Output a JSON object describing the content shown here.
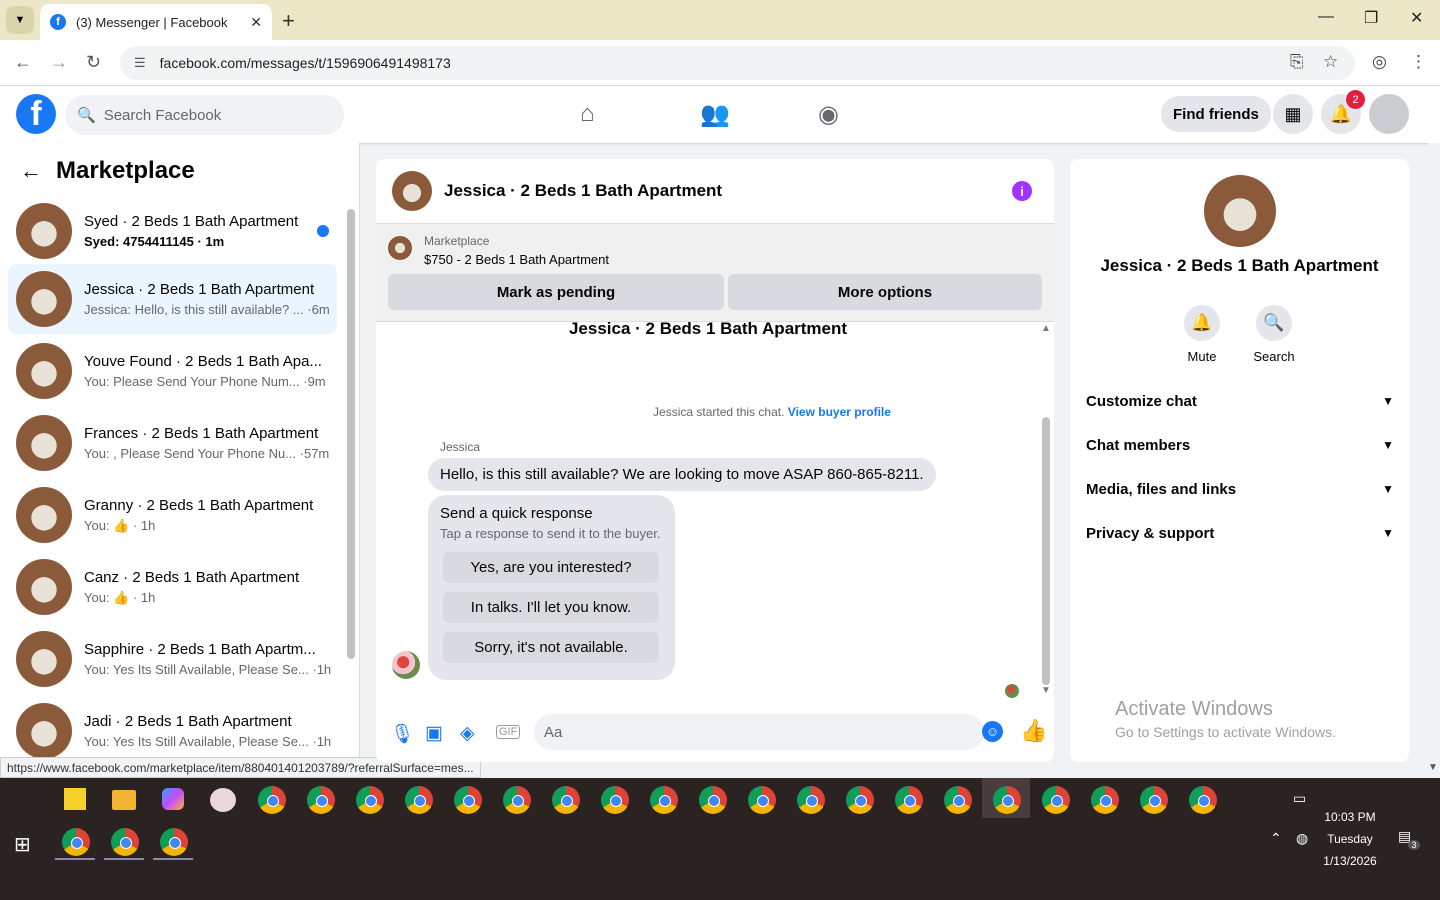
{
  "browser": {
    "tab_title": "(3) Messenger | Facebook",
    "url": "facebook.com/messages/t/1596906491498173",
    "status_url": "https://www.facebook.com/marketplace/item/880401401203789/?referralSurface=mes..."
  },
  "header": {
    "search_placeholder": "Search Facebook",
    "find_friends_label": "Find friends",
    "notification_count": "2"
  },
  "sidebar": {
    "title": "Marketplace",
    "conversations": [
      {
        "name": "Syed · 2 Beds 1 Bath Apartment",
        "preview": "Syed: 4754411145 · 1m",
        "unread": true
      },
      {
        "name": "Jessica · 2 Beds 1 Bath Apartment",
        "preview": "Jessica: Hello, is this still available? ... ·6m"
      },
      {
        "name": "Youve Found · 2 Beds 1 Bath Apa...",
        "preview": "You: Please Send Your Phone Num... ·9m"
      },
      {
        "name": "Frances · 2 Beds 1 Bath Apartment",
        "preview": "You: , Please Send Your Phone Nu... ·57m"
      },
      {
        "name": "Granny · 2 Beds 1 Bath Apartment",
        "preview": "You: 👍 · 1h"
      },
      {
        "name": "Canz · 2 Beds 1 Bath Apartment",
        "preview": "You: 👍 · 1h"
      },
      {
        "name": "Sapphire · 2 Beds 1 Bath Apartm...",
        "preview": "You: Yes Its Still Available, Please Se... ·1h"
      },
      {
        "name": "Jadi · 2 Beds 1 Bath Apartment",
        "preview": "You: Yes Its Still Available, Please Se... ·1h"
      }
    ]
  },
  "chat": {
    "title": "Jessica · 2 Beds 1 Bath Apartment",
    "listing_label": "Marketplace",
    "listing_price": "$750 - 2 Beds 1 Bath Apartment",
    "mark_pending_label": "Mark as pending",
    "more_options_label": "More options",
    "thread_title": "Jessica · 2 Beds 1 Bath Apartment",
    "started_text": "Jessica started this chat.",
    "view_buyer_profile": "View buyer profile",
    "sender_name": "Jessica",
    "message": "Hello, is this still available? We are looking to move ASAP 860-865-8211.",
    "quick_title": "Send a quick response",
    "quick_sub": "Tap a response to send it to the buyer.",
    "quick_responses": [
      "Yes, are you interested?",
      "In talks. I'll let you know.",
      "Sorry, it's not available."
    ],
    "composer_placeholder": "Aa"
  },
  "details": {
    "name": "Jessica · 2 Beds 1 Bath Apartment",
    "mute_label": "Mute",
    "search_label": "Search",
    "sections": [
      "Customize chat",
      "Chat members",
      "Media, files and links",
      "Privacy & support"
    ]
  },
  "watermark": {
    "line1": "Activate Windows",
    "line2": "Go to Settings to activate Windows."
  },
  "taskbar": {
    "time": "10:03 PM",
    "day": "Tuesday",
    "date": "1/13/2026",
    "notification_count": "3"
  },
  "colors": {
    "facebook_blue": "#1877f2",
    "info_purple": "#a033ff",
    "badge_red": "#e41e3f"
  }
}
